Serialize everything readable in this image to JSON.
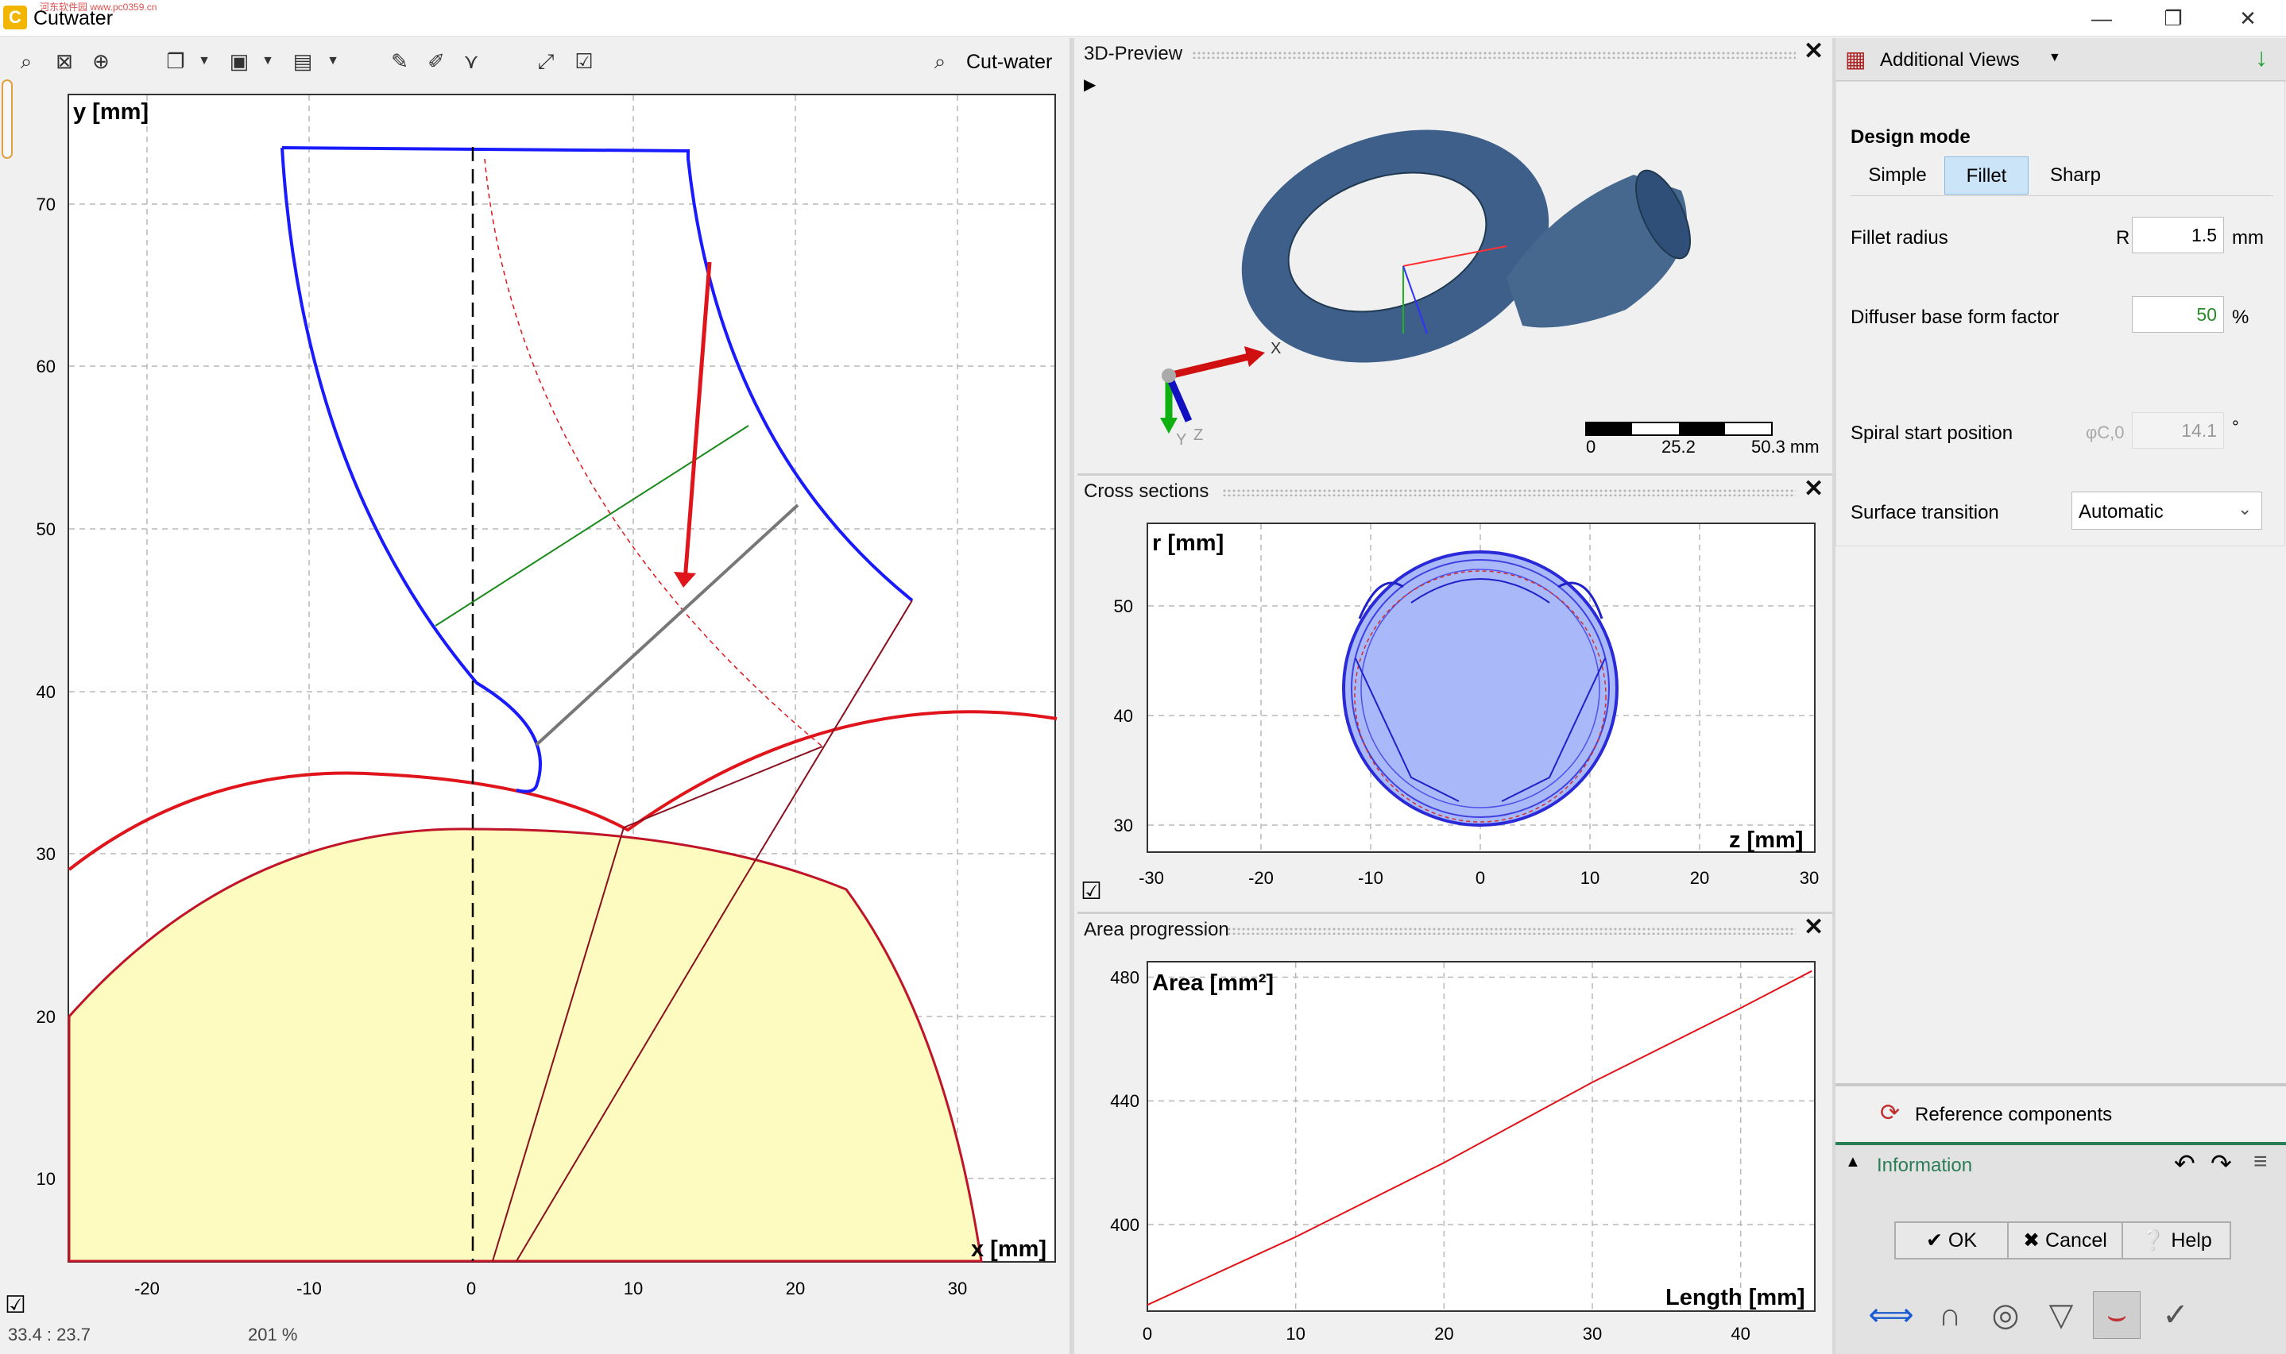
{
  "app": {
    "title": "Cutwater",
    "watermark": "河东软件园 www.pc0359.cn"
  },
  "window": {
    "minimize": "—",
    "maximize": "❐",
    "close": "✕"
  },
  "main_view": {
    "name": "Cut-water",
    "x_label": "x [mm]",
    "y_label": "y [mm]",
    "x_ticks": [
      "-20",
      "-10",
      "0",
      "10",
      "20",
      "30"
    ],
    "y_ticks": [
      "10",
      "20",
      "30",
      "40",
      "50",
      "60",
      "70"
    ],
    "status_coords": "33.4 : 23.7",
    "status_zoom": "201 %"
  },
  "preview3d": {
    "title": "3D-Preview",
    "scale_labels": [
      "0",
      "25.2",
      "50.3 mm"
    ],
    "axis_x": "X",
    "axis_y": "Y",
    "axis_z": "Z"
  },
  "cross_sections": {
    "title": "Cross sections",
    "x_label": "z [mm]",
    "y_label": "r [mm]",
    "x_ticks": [
      "-30",
      "-20",
      "-10",
      "0",
      "10",
      "20",
      "30"
    ],
    "y_ticks": [
      "30",
      "40",
      "50"
    ]
  },
  "area_progression": {
    "title": "Area progression",
    "x_label": "Length [mm]",
    "y_label": "Area [mm²]",
    "x_ticks": [
      "0",
      "10",
      "20",
      "30",
      "40"
    ],
    "y_ticks": [
      "400",
      "440",
      "480"
    ],
    "chart_data": {
      "type": "line",
      "title": "",
      "xlabel": "Length [mm]",
      "ylabel": "Area [mm²]",
      "xlim": [
        0,
        45
      ],
      "ylim": [
        372,
        485
      ],
      "grid": true,
      "series": [
        {
          "x": [
            0,
            10,
            20,
            30,
            40,
            44.8
          ],
          "values": [
            374,
            396,
            420,
            446,
            470,
            482
          ]
        }
      ]
    }
  },
  "side_panel": {
    "header": "Additional Views",
    "design_mode_label": "Design mode",
    "modes": [
      "Simple",
      "Fillet",
      "Sharp"
    ],
    "active_mode": "Fillet",
    "fillet_radius": {
      "label": "Fillet radius",
      "symbol": "R",
      "value": "1.5",
      "unit": "mm"
    },
    "diffuser": {
      "label": "Diffuser base form factor",
      "value": "50",
      "unit": "%"
    },
    "spiral": {
      "label": "Spiral start position",
      "symbol": "φC,0",
      "value": "14.1",
      "unit": "°"
    },
    "surface": {
      "label": "Surface transition",
      "value": "Automatic"
    },
    "reference": "Reference components",
    "information": "Information",
    "ok": "OK",
    "cancel": "Cancel",
    "help": "Help"
  },
  "colors": {
    "accent": "#0078d4",
    "curve_blue": "#1a1aff",
    "curve_red": "#e0151b",
    "fill_yellow": "#fdfbbf",
    "grid": "#b8b8b8",
    "info_green": "#2b7d57"
  }
}
